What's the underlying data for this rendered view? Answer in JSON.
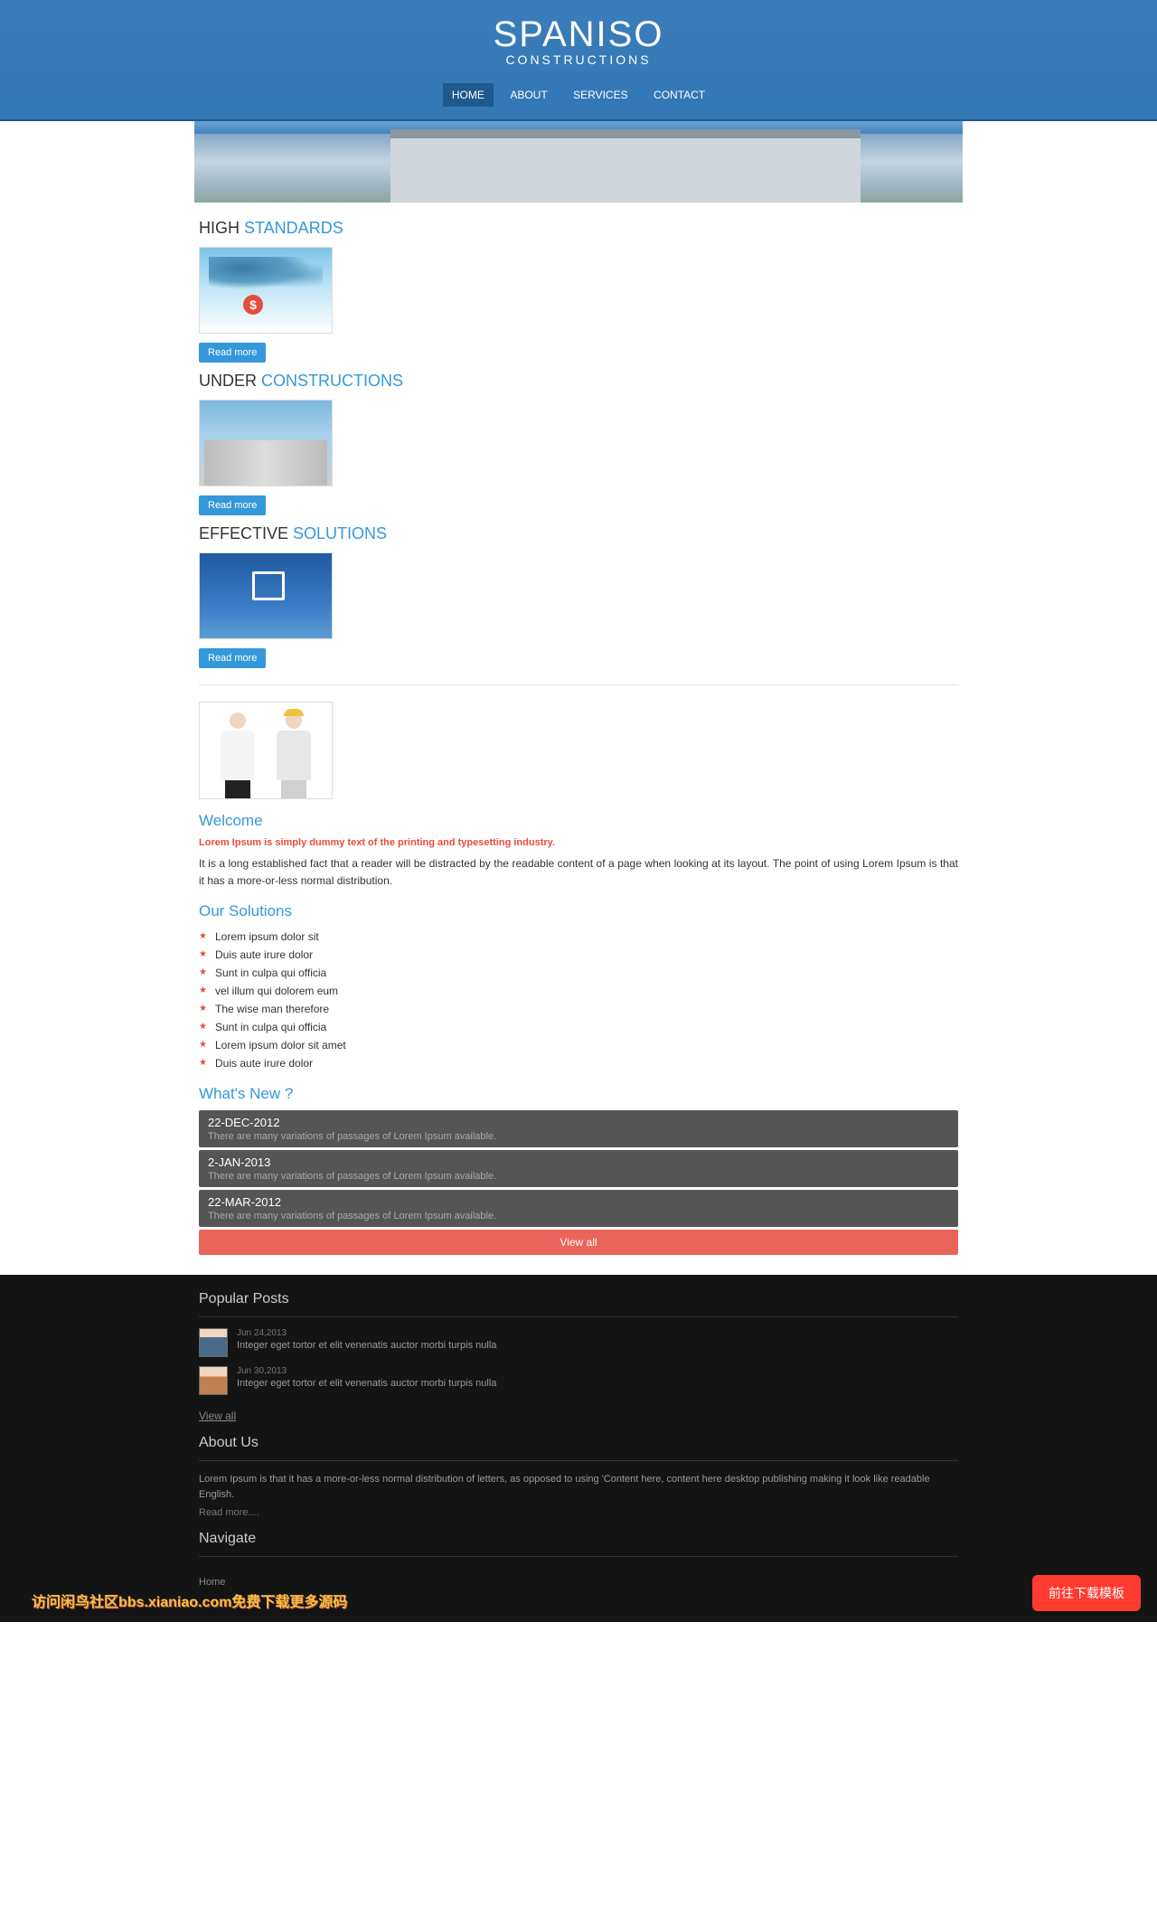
{
  "brand": {
    "title": "SPANISO",
    "subtitle": "CONSTRUCTIONS"
  },
  "nav": {
    "home": "HOME",
    "about": "ABOUT",
    "services": "SERVICES",
    "contact": "CONTACT"
  },
  "sections": [
    {
      "t1": "HIGH ",
      "t2": "STANDARDS",
      "btn": "Read more"
    },
    {
      "t1": "UNDER ",
      "t2": "CONSTRUCTIONS",
      "btn": "Read more"
    },
    {
      "t1": "EFFECTIVE ",
      "t2": "SOLUTIONS",
      "btn": "Read more"
    }
  ],
  "welcome": {
    "title": "Welcome",
    "red": "Lorem Ipsum is simply dummy text of the printing and typesetting industry.",
    "text": "It is a long established fact that a reader will be distracted by the readable content of a page when looking at its layout. The point of using Lorem Ipsum is that it has a more-or-less normal distribution."
  },
  "solutions": {
    "title": "Our Solutions",
    "items": [
      "Lorem ipsum dolor sit",
      "Duis aute irure dolor",
      "Sunt in culpa qui officia",
      "vel illum qui dolorem eum",
      "The wise man therefore",
      "Sunt in culpa qui officia",
      "Lorem ipsum dolor sit amet",
      "Duis aute irure dolor"
    ]
  },
  "news": {
    "title": "What's New ?",
    "items": [
      {
        "date": "22-DEC-2012",
        "text": "There are many variations of passages of Lorem Ipsum available."
      },
      {
        "date": "2-JAN-2013",
        "text": "There are many variations of passages of Lorem Ipsum available."
      },
      {
        "date": "22-MAR-2012",
        "text": "There are many variations of passages of Lorem Ipsum available."
      }
    ],
    "viewall": "View all"
  },
  "footer": {
    "popular": {
      "title": "Popular Posts",
      "posts": [
        {
          "date": "Jun 24,2013",
          "text": "Integer eget tortor et elit venenatis auctor morbi turpis nulla"
        },
        {
          "date": "Jun 30,2013",
          "text": "Integer eget tortor et elit venenatis auctor morbi turpis nulla"
        }
      ],
      "viewall": "View all"
    },
    "about": {
      "title": "About Us",
      "text": "Lorem Ipsum is that it has a more-or-less normal distribution of letters, as opposed to using 'Content here, content here desktop publishing making it look like readable English.",
      "readmore": "Read more...."
    },
    "navigate": {
      "title": "Navigate",
      "home": "Home"
    },
    "redbtn": "前往下载模板",
    "watermark": "访问闲鸟社区bbs.xianiao.com免费下载更多源码"
  }
}
